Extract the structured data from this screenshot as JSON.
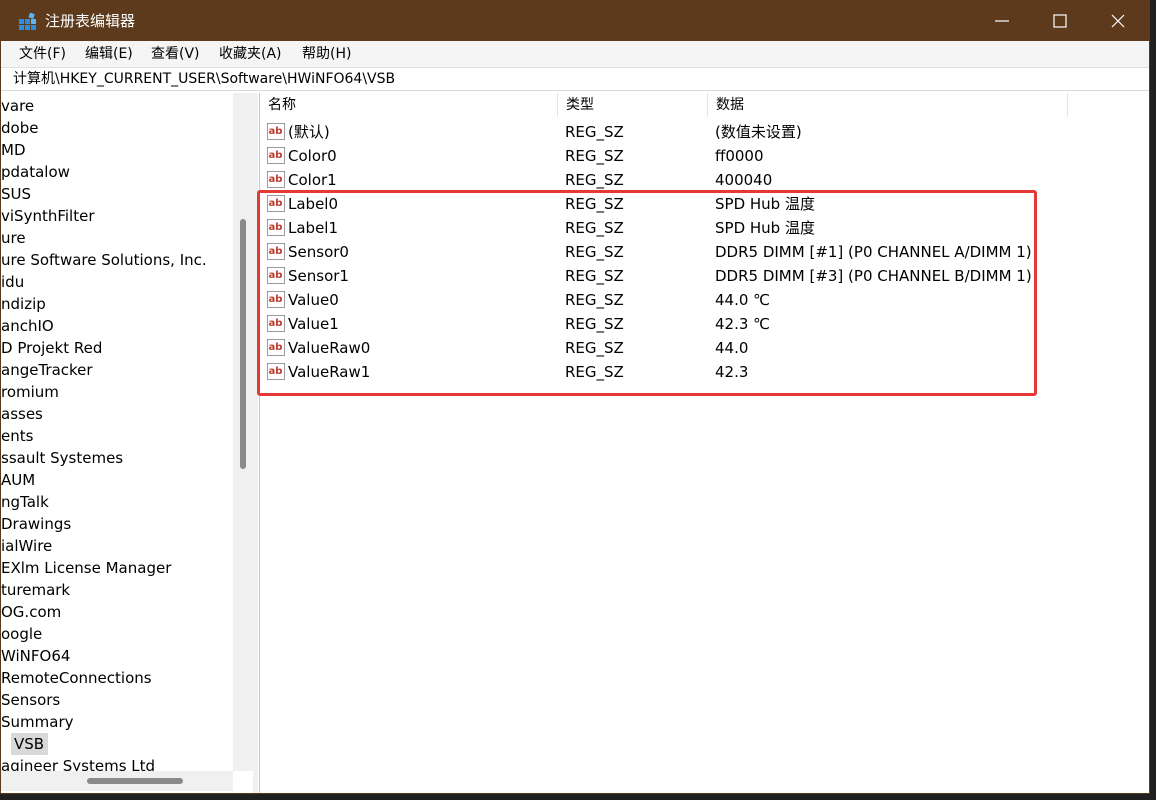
{
  "window": {
    "title": "注册表编辑器",
    "accent_color": "#5c3a1b"
  },
  "menu": [
    "文件(F)",
    "编辑(E)",
    "查看(V)",
    "收藏夹(A)",
    "帮助(H)"
  ],
  "address": "计算机\\HKEY_CURRENT_USER\\Software\\HWiNFO64\\VSB",
  "tree": {
    "items": [
      "vare",
      "dobe",
      "MD",
      "pdatalow",
      "SUS",
      "viSynthFilter",
      "ure",
      "ure Software Solutions, Inc.",
      "idu",
      "ndizip",
      "anchIO",
      "D Projekt Red",
      "angeTracker",
      "romium",
      "asses",
      "ents",
      "ssault Systemes",
      "AUM",
      "ngTalk",
      "Drawings",
      "ialWire",
      "EXlm License Manager",
      "turemark",
      "OG.com",
      "oogle",
      "WiNFO64",
      "RemoteConnections",
      "Sensors",
      "Summary",
      "VSB",
      "agineer Systems Ltd"
    ],
    "selected": "VSB"
  },
  "list": {
    "headers": {
      "name": "名称",
      "type": "类型",
      "data": "数据"
    },
    "icon": "string-value-icon",
    "rows": [
      {
        "name": "(默认)",
        "type": "REG_SZ",
        "data": "(数值未设置)"
      },
      {
        "name": "Color0",
        "type": "REG_SZ",
        "data": "ff0000"
      },
      {
        "name": "Color1",
        "type": "REG_SZ",
        "data": "400040"
      },
      {
        "name": "Label0",
        "type": "REG_SZ",
        "data": "SPD Hub 温度"
      },
      {
        "name": "Label1",
        "type": "REG_SZ",
        "data": "SPD Hub 温度"
      },
      {
        "name": "Sensor0",
        "type": "REG_SZ",
        "data": "DDR5 DIMM [#1] (P0 CHANNEL A/DIMM 1)"
      },
      {
        "name": "Sensor1",
        "type": "REG_SZ",
        "data": "DDR5 DIMM [#3] (P0 CHANNEL B/DIMM 1)"
      },
      {
        "name": "Value0",
        "type": "REG_SZ",
        "data": "44.0 ℃"
      },
      {
        "name": "Value1",
        "type": "REG_SZ",
        "data": "42.3 ℃"
      },
      {
        "name": "ValueRaw0",
        "type": "REG_SZ",
        "data": "44.0"
      },
      {
        "name": "ValueRaw1",
        "type": "REG_SZ",
        "data": "42.3"
      }
    ]
  },
  "annotation": {
    "color": "#e53935"
  }
}
